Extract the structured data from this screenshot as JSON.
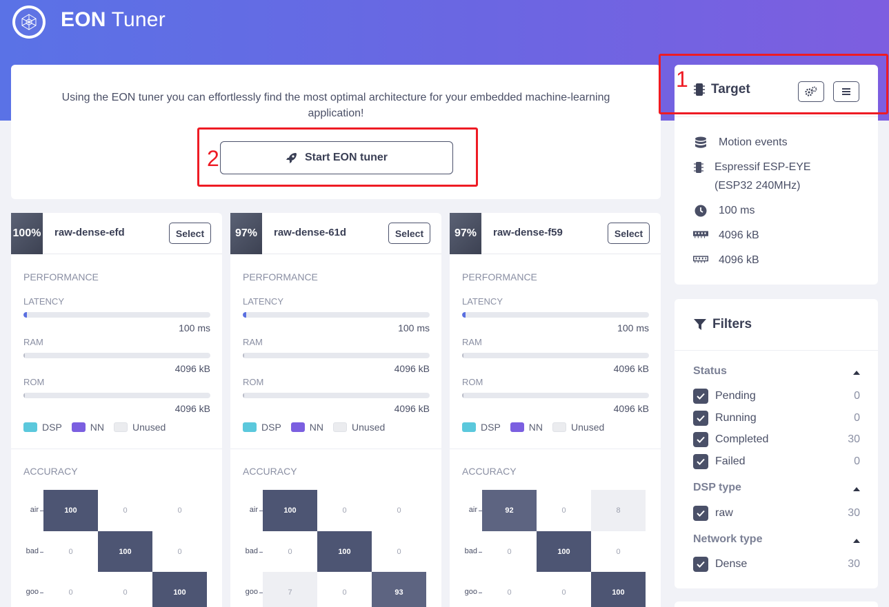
{
  "app": {
    "title_bold": "EON",
    "title_rest": "Tuner"
  },
  "intro": {
    "text": "Using the EON tuner you can effortlessly find the most optimal architecture for your embedded machine-learning application!",
    "start_label": "Start EON tuner"
  },
  "annotations": {
    "one": "1",
    "two": "2"
  },
  "labels": {
    "performance": "PERFORMANCE",
    "latency": "LATENCY",
    "ram": "RAM",
    "rom": "ROM",
    "accuracy": "ACCURACY",
    "select": "Select",
    "dsp": "DSP",
    "nn": "NN",
    "unused": "Unused"
  },
  "legend_colors": {
    "dsp": "#5bc8dc",
    "nn": "#7b5fe0",
    "unused": "#ebecef"
  },
  "results": [
    {
      "score": "100%",
      "name": "raw-dense-efd",
      "latency": "100 ms",
      "ram": "4096 kB",
      "rom": "4096 kB",
      "latency_fill": 0.02,
      "classes": [
        "air",
        "bad",
        "goo"
      ],
      "matrix": [
        [
          "100",
          "0",
          "0"
        ],
        [
          "0",
          "100",
          "0"
        ],
        [
          "0",
          "0",
          "100"
        ]
      ]
    },
    {
      "score": "97%",
      "name": "raw-dense-61d",
      "latency": "100 ms",
      "ram": "4096 kB",
      "rom": "4096 kB",
      "latency_fill": 0.02,
      "classes": [
        "air",
        "bad",
        "goo"
      ],
      "matrix": [
        [
          "100",
          "0",
          "0"
        ],
        [
          "0",
          "100",
          "0"
        ],
        [
          "7",
          "0",
          "93"
        ]
      ]
    },
    {
      "score": "97%",
      "name": "raw-dense-f59",
      "latency": "100 ms",
      "ram": "4096 kB",
      "rom": "4096 kB",
      "latency_fill": 0.02,
      "classes": [
        "air",
        "bad",
        "goo"
      ],
      "matrix": [
        [
          "92",
          "0",
          "8"
        ],
        [
          "0",
          "100",
          "0"
        ],
        [
          "0",
          "0",
          "100"
        ]
      ]
    }
  ],
  "target": {
    "title": "Target",
    "rows": [
      {
        "icon": "database-icon",
        "text": "Motion events"
      },
      {
        "icon": "chip-icon",
        "text": "Espressif ESP-EYE (ESP32 240MHz)"
      },
      {
        "icon": "clock-icon",
        "text": "100 ms"
      },
      {
        "icon": "ram-icon",
        "text": "4096 kB"
      },
      {
        "icon": "rom-icon",
        "text": "4096 kB"
      }
    ]
  },
  "filters": {
    "title": "Filters",
    "groups": [
      {
        "label": "Status",
        "items": [
          {
            "label": "Pending",
            "count": "0"
          },
          {
            "label": "Running",
            "count": "0"
          },
          {
            "label": "Completed",
            "count": "30"
          },
          {
            "label": "Failed",
            "count": "0"
          }
        ]
      },
      {
        "label": "DSP type",
        "items": [
          {
            "label": "raw",
            "count": "30"
          }
        ]
      },
      {
        "label": "Network type",
        "items": [
          {
            "label": "Dense",
            "count": "30"
          }
        ]
      }
    ]
  }
}
